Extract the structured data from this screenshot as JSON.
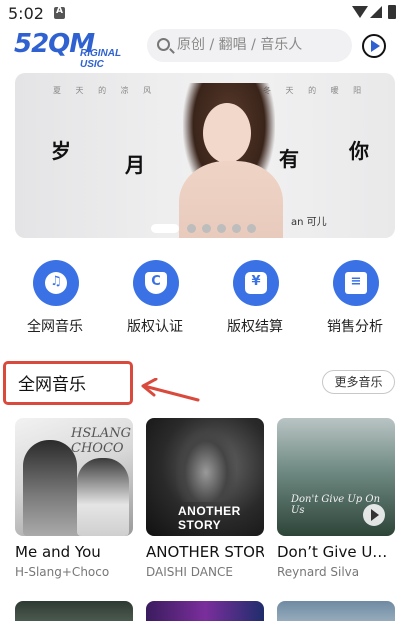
{
  "status_bar": {
    "time": "5:02"
  },
  "header": {
    "logo_main": "52QM",
    "logo_sub": "RIGINAL USIC",
    "search_placeholder": "原创 / 翻唱 / 音乐人"
  },
  "banner": {
    "poem_left": "夏 天 的 凉 风",
    "poem_right": "冬 天 的 暖 阳",
    "big_chars": [
      "岁",
      "月",
      "有",
      "你"
    ],
    "caption": "an 可儿",
    "dots_total": 6,
    "active_dot": 0
  },
  "actions": [
    {
      "label": "全网音乐",
      "icon": "music-disc-icon"
    },
    {
      "label": "版权认证",
      "icon": "copyright-shield-icon"
    },
    {
      "label": "版权结算",
      "icon": "yuan-wallet-icon"
    },
    {
      "label": "销售分析",
      "icon": "report-book-icon"
    }
  ],
  "section": {
    "title": "全网音乐",
    "more_label": "更多音乐"
  },
  "cards": [
    {
      "title": "Me and You",
      "artist": "H-Slang+Choco",
      "cover_text": "HSLANG CHOCO"
    },
    {
      "title": "ANOTHER STOR",
      "artist": "DAISHI DANCE",
      "cover_text": "ANOTHER STORY"
    },
    {
      "title": "Don’t Give U…",
      "artist": "Reynard Silva",
      "cover_text": "Don't Give Up On Us"
    }
  ]
}
